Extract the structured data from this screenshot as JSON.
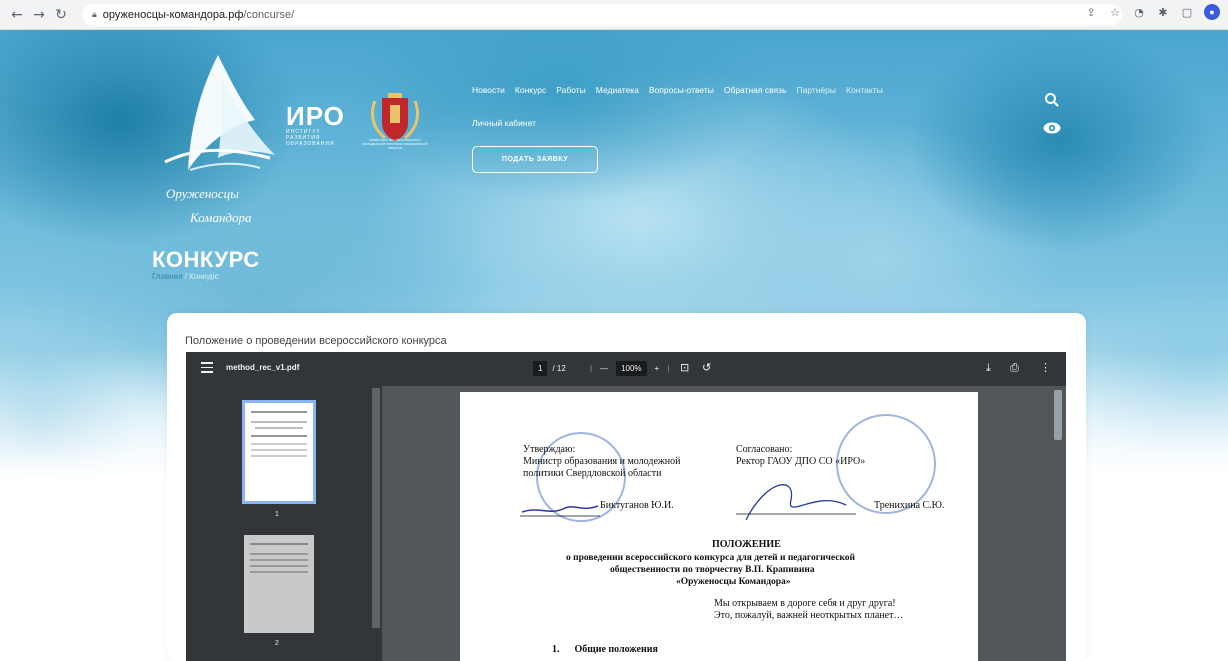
{
  "browser": {
    "url_host": "оруженосцы-командора.рф",
    "url_path": "/concurse/"
  },
  "header": {
    "logo_text_line1": "Оруженосцы",
    "logo_text_line2": "Командора",
    "iro_abbr": "ИРО",
    "iro_full": "ИНСТИТУТ РАЗВИТИЯ ОБРАЗОВАНИЯ",
    "ministry_text": "МИНИСТЕРСТВО ОБРАЗОВАНИЯ И МОЛОДЕЖНОЙ ПОЛИТИКИ СВЕРДЛОВСКОЙ ОБЛАСТИ",
    "menu": [
      "Новости",
      "Конкурс",
      "Работы",
      "Медиатека",
      "Вопросы-ответы",
      "Обратная связь",
      "Партнёры",
      "Контакты"
    ],
    "cabinet": "Личный кабинет",
    "apply_button": "ПОДАТЬ ЗАЯВКУ"
  },
  "page": {
    "title": "КОНКУРС",
    "breadcrumb_home": "Главная",
    "breadcrumb_current": "/ Конкурс",
    "card_title": "Положение о проведении всероссийского конкурса"
  },
  "pdf": {
    "filename": "method_rec_v1.pdf",
    "current_page": "1",
    "total_pages": "/ 12",
    "zoom": "100%",
    "thumb_labels": [
      "1",
      "2"
    ],
    "content": {
      "approve_title": "Утверждаю:",
      "approve_line1": "Министр образования и молодежной",
      "approve_line2": "политики Свердловской области",
      "approve_sign": "Биктуганов Ю.И.",
      "agreed_title": "Согласовано:",
      "agreed_line1": "Ректор ГАОУ ДПО СО «ИРО»",
      "agreed_sign": "Тренихина С.Ю.",
      "doc_title": "ПОЛОЖЕНИЕ",
      "doc_sub1": "о проведении всероссийского конкурса для детей и педагогической",
      "doc_sub2": "общественности по творчеству В.П. Крапивина",
      "doc_sub3": "«Оруженосцы Командора»",
      "epigraph1": "Мы открываем в дороге себя и друг друга!",
      "epigraph2": "Это, пожалуй, важней неоткрытых планет…",
      "section1": "1.      Общие положения"
    }
  }
}
